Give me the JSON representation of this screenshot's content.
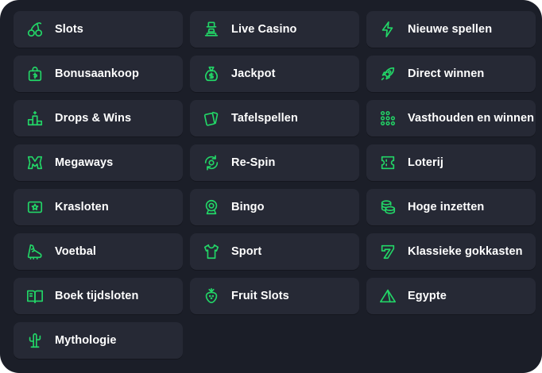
{
  "accent_color": "#22d667",
  "categories": [
    {
      "label": "Slots",
      "icon": "cherries-icon"
    },
    {
      "label": "Live Casino",
      "icon": "dealer-icon"
    },
    {
      "label": "Nieuwe spellen",
      "icon": "lightning-icon"
    },
    {
      "label": "Bonusaankoop",
      "icon": "gift-bag-icon"
    },
    {
      "label": "Jackpot",
      "icon": "money-bag-icon"
    },
    {
      "label": "Direct winnen",
      "icon": "rocket-icon"
    },
    {
      "label": "Drops & Wins",
      "icon": "podium-icon"
    },
    {
      "label": "Tafelspellen",
      "icon": "cards-icon"
    },
    {
      "label": "Vasthouden en winnen",
      "icon": "dots-grid-icon"
    },
    {
      "label": "Megaways",
      "icon": "megaways-m-icon"
    },
    {
      "label": "Re-Spin",
      "icon": "respin-icon"
    },
    {
      "label": "Loterij",
      "icon": "ticket-icon"
    },
    {
      "label": "Krasloten",
      "icon": "scratch-card-icon"
    },
    {
      "label": "Bingo",
      "icon": "bingo-ball-icon"
    },
    {
      "label": "Hoge inzetten",
      "icon": "coin-stack-icon"
    },
    {
      "label": "Voetbal",
      "icon": "football-boot-icon"
    },
    {
      "label": "Sport",
      "icon": "jersey-icon"
    },
    {
      "label": "Klassieke gokkasten",
      "icon": "seven-icon"
    },
    {
      "label": "Boek tijdsloten",
      "icon": "book-icon"
    },
    {
      "label": "Fruit Slots",
      "icon": "strawberry-icon"
    },
    {
      "label": "Egypte",
      "icon": "pyramid-icon"
    },
    {
      "label": "Mythologie",
      "icon": "cactus-icon"
    }
  ]
}
